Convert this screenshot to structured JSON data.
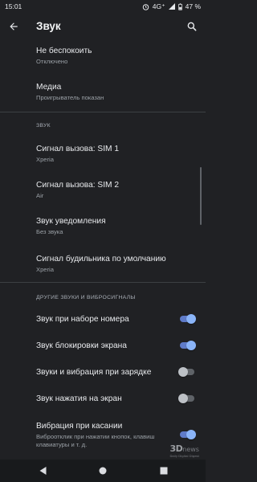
{
  "status": {
    "time": "15:01",
    "network": "4G⁺",
    "battery": "47 %"
  },
  "toolbar": {
    "title": "Звук"
  },
  "top_items": [
    {
      "title": "Не беспокоить",
      "subtitle": "Отключено"
    },
    {
      "title": "Медиа",
      "subtitle": "Проигрыватель показан"
    }
  ],
  "section_sound": {
    "header": "ЗВУК",
    "items": [
      {
        "title": "Сигнал вызова: SIM 1",
        "subtitle": "Xperia"
      },
      {
        "title": "Сигнал вызова: SIM 2",
        "subtitle": "Air"
      },
      {
        "title": "Звук уведомления",
        "subtitle": "Без звука"
      },
      {
        "title": "Сигнал будильника по умолчанию",
        "subtitle": "Xperia"
      }
    ]
  },
  "section_other": {
    "header": "ДРУГИЕ ЗВУКИ И ВИБРОСИГНАЛЫ",
    "toggles": [
      {
        "title": "Звук при наборе номера",
        "on": true
      },
      {
        "title": "Звук блокировки экрана",
        "on": true
      },
      {
        "title": "Звуки и вибрация при зарядке",
        "on": false
      },
      {
        "title": "Звук нажатия на экран",
        "on": false
      },
      {
        "title": "Вибрация при касании",
        "subtitle": "Виброотклик при нажатии кнопок, клавиш клавиатуры и т. д.",
        "on": true
      }
    ]
  },
  "watermark": {
    "logo": "3D",
    "text": "news",
    "tagline": "Daily Digital Digest"
  },
  "colors": {
    "background": "#202124",
    "toggle_on": "#8ab4f8",
    "toggle_off": "#bdc1c6",
    "divider": "#3c4043"
  }
}
